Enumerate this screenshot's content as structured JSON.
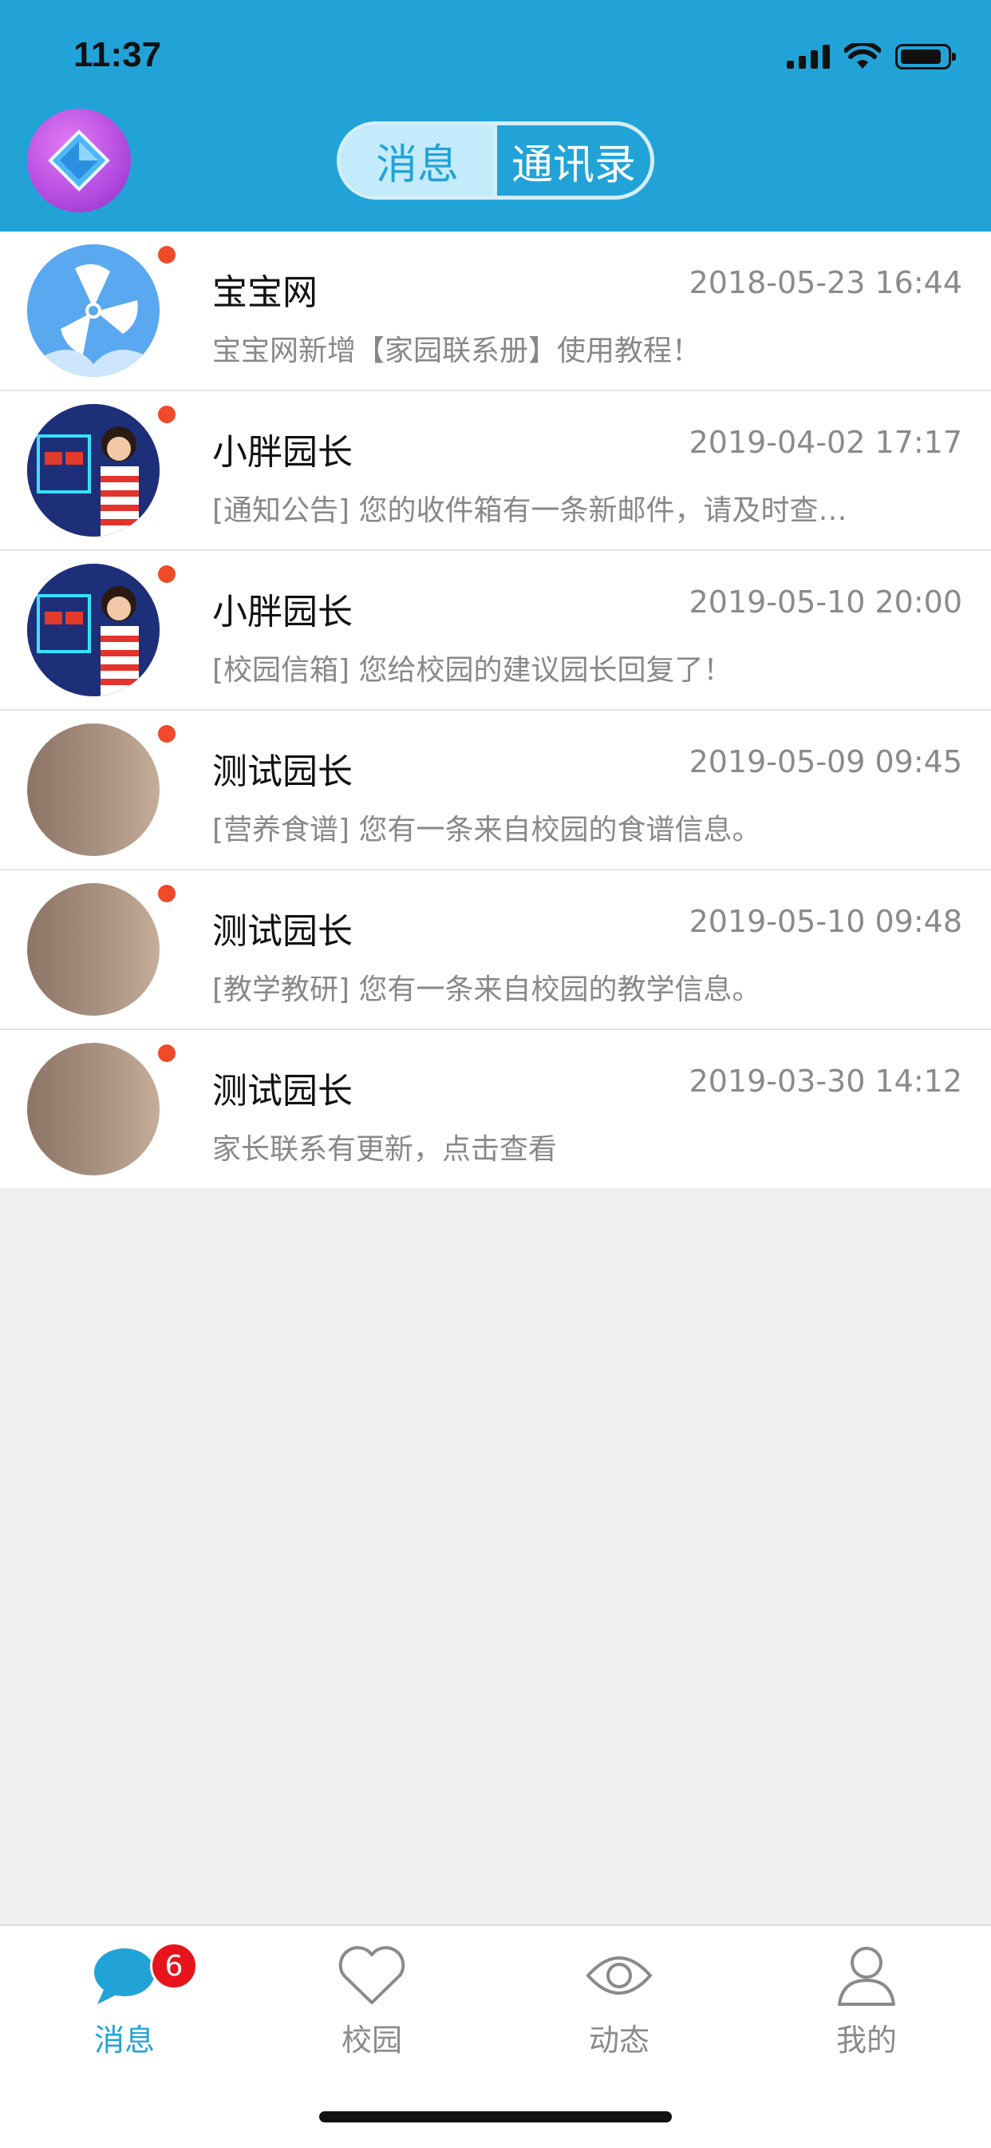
{
  "status_bar": {
    "time": "11:37"
  },
  "header": {
    "segments": [
      {
        "label": "消息",
        "active": false
      },
      {
        "label": "通讯录",
        "active": true
      }
    ]
  },
  "messages": [
    {
      "name": "宝宝网",
      "time": "2018-05-23 16:44",
      "preview": "宝宝网新增【家园联系册】使用教程！",
      "avatar": "fan-logo",
      "unread": true
    },
    {
      "name": "小胖园长",
      "time": "2019-04-02 17:17",
      "preview": "[通知公告] 您的收件箱有一条新邮件，请及时查…",
      "avatar": "photo",
      "unread": true
    },
    {
      "name": "小胖园长",
      "time": "2019-05-10 20:00",
      "preview": "[校园信箱] 您给校园的建议园长回复了！",
      "avatar": "photo",
      "unread": true
    },
    {
      "name": "测试园长",
      "time": "2019-05-09 09:45",
      "preview": "[营养食谱] 您有一条来自校园的食谱信息。",
      "avatar": "plain",
      "unread": true
    },
    {
      "name": "测试园长",
      "time": "2019-05-10 09:48",
      "preview": "[教学教研] 您有一条来自校园的教学信息。",
      "avatar": "plain",
      "unread": true
    },
    {
      "name": "测试园长",
      "time": "2019-03-30 14:12",
      "preview": "家长联系有更新，点击查看",
      "avatar": "plain",
      "unread": true
    }
  ],
  "tabbar": {
    "tabs": [
      {
        "label": "消息",
        "icon": "chat-bubble-icon",
        "active": true,
        "badge": "6"
      },
      {
        "label": "校园",
        "icon": "heart-icon",
        "active": false
      },
      {
        "label": "动态",
        "icon": "eye-icon",
        "active": false
      },
      {
        "label": "我的",
        "icon": "person-icon",
        "active": false
      }
    ]
  },
  "colors": {
    "primary": "#22a3d8",
    "unread_dot": "#ef4a2a",
    "badge": "#e8141c"
  }
}
